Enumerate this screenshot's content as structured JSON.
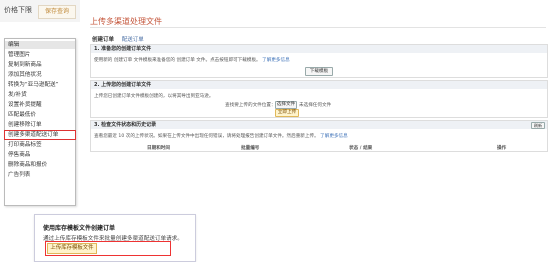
{
  "header": {
    "title": "价格下限",
    "save_label": "保存查询"
  },
  "menu": {
    "items": [
      "编辑",
      "管理图片",
      "复制到新商品",
      "添加其他状况",
      "转换为“亚马逊配送”",
      "发/补货",
      "设置补货提醒",
      "匹配最低价",
      "创建移除订单",
      "创建多渠道配送订单",
      "打印商品标签",
      "停售商品",
      "删除商品和报价",
      "广告列表"
    ],
    "selected_index": 0,
    "highlighted_index": 9
  },
  "page": {
    "title": "上传多渠道处理文件",
    "tabs": [
      "创建订单",
      "配送订单"
    ],
    "section1": {
      "header": "1. 准备您的创建订单文件",
      "text": "使用新的 创建订单 文件模板来准备您的 创建订单 文件。点击按钮即可下载模板。",
      "link": "了解更多信息",
      "button": "下载模板"
    },
    "section2": {
      "header": "2. 上传您的创建订单文件",
      "text": "上传您已创建订单文件模板创建的，以将其导出到亚马逊。",
      "file_label": "查找要上传的文件位置：",
      "choose_btn": "选择文件",
      "no_file": "未选择任何文件",
      "upload_btn": "立即上传"
    },
    "section3": {
      "header": "3. 检查文件状态和历史记录",
      "refresh": "刷新",
      "text": "查看您最近 10 次的上传状况。如果在上传文件中出现任何错误，请将处理报告创建订单文件。然后重新上传。",
      "link": "了解更多信息",
      "columns": [
        "日期和时间",
        "批量编号",
        "状态 / 结果",
        "操作"
      ]
    }
  },
  "card": {
    "title": "使用库存模板文件创建订单",
    "desc": "通过上传库存模板文件来批量创建多渠道配送订单请求。",
    "button": "上传库存模板文件"
  }
}
